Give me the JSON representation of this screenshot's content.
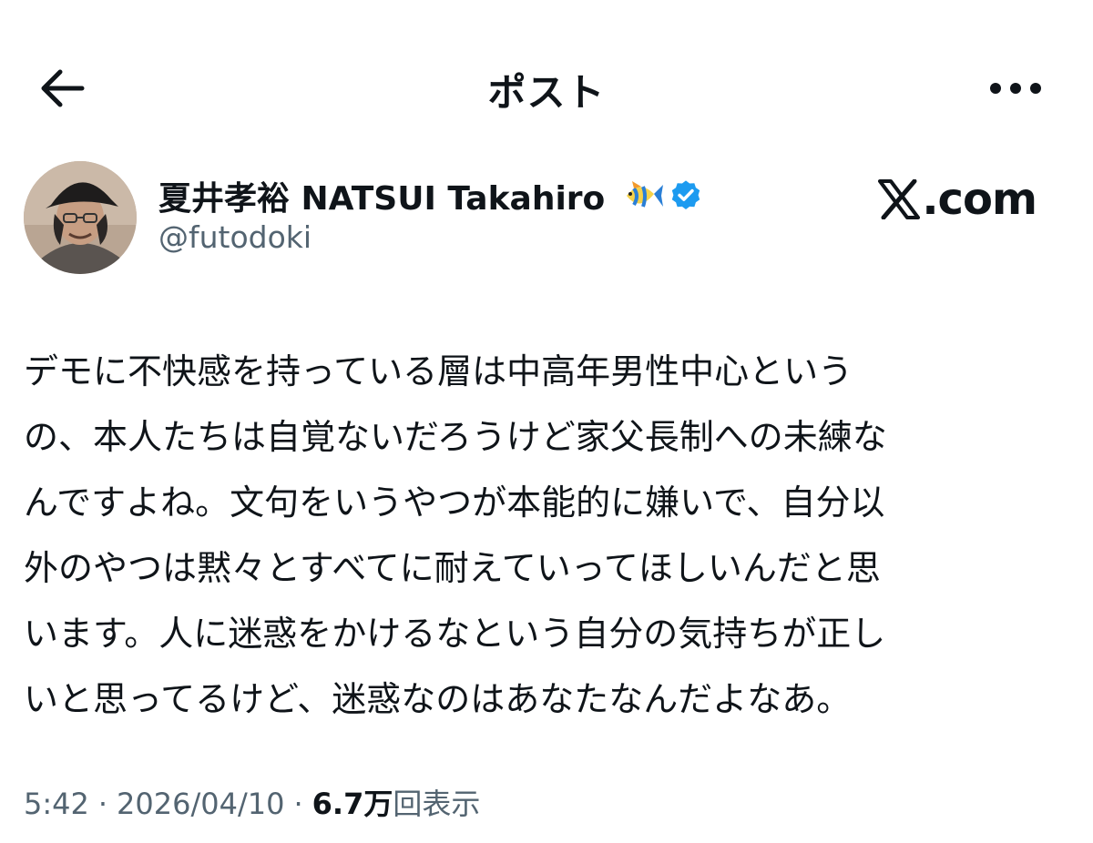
{
  "header": {
    "title": "ポスト",
    "back_icon": "arrow-left-icon",
    "more_icon": "more-horizontal-icon"
  },
  "author": {
    "display_name": "夏井孝裕 NATSUI Takahiro",
    "handle": "@futodoki",
    "emoji_icon": "tropical-fish-icon",
    "verified_icon": "verified-badge-icon",
    "verified_color": "#1d9bf0"
  },
  "branding": {
    "logo_icon": "x-logo-icon",
    "domain_suffix": ".com"
  },
  "tweet": {
    "lines": [
      "デモに不快感を持っている層は中高年男性中心という",
      "の、本人たちは自覚ないだろうけど家父長制への未練な",
      "んですよね。文句をいうやつが本能的に嫌いで、自分以",
      "外のやつは黙々とすべてに耐えていってほしいんだと思",
      "います。人に迷惑をかけるなという自分の気持ちが正し",
      "いと思ってるけど、迷惑なのはあなたなんだよなあ。"
    ]
  },
  "meta": {
    "time": "5:42",
    "separator": "·",
    "date": "2026/04/10",
    "views_count": "6.7万",
    "views_label": "回表示"
  },
  "colors": {
    "text": "#0f1419",
    "secondary": "#536471",
    "accent": "#1d9bf0"
  }
}
